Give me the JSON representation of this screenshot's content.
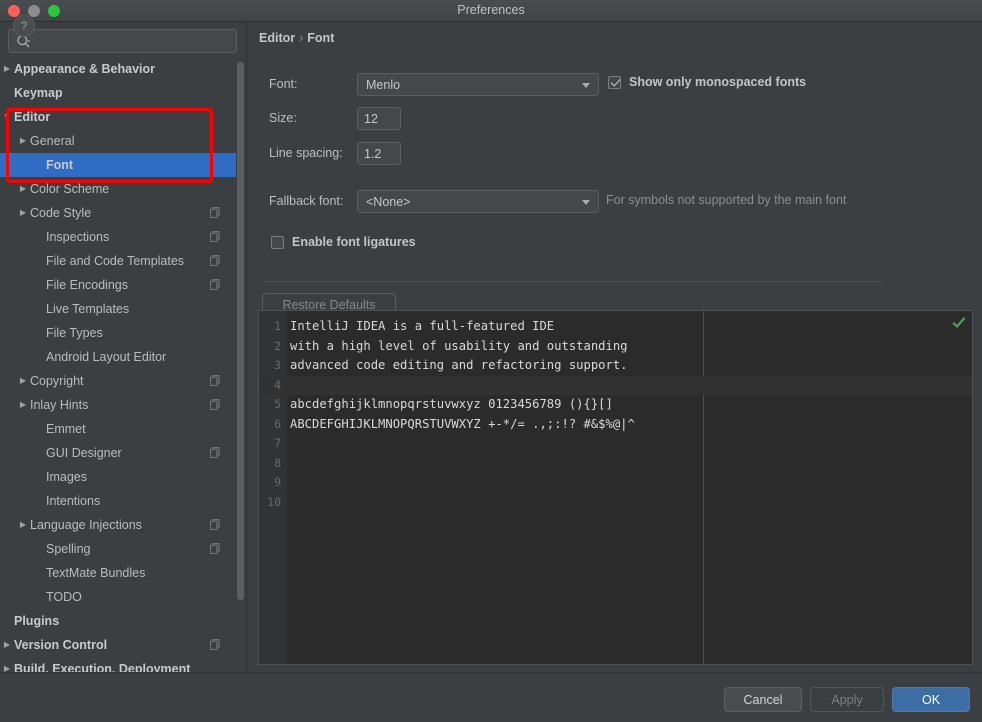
{
  "window": {
    "title": "Preferences",
    "traffic_lights": [
      "close-button",
      "minimize-button",
      "zoom-button"
    ]
  },
  "search": {
    "value": "",
    "placeholder": "",
    "icon": "search-icon"
  },
  "sidebar": {
    "items": [
      {
        "label": "Appearance & Behavior",
        "indent": 0,
        "twisty": "collapsed",
        "bold": true,
        "copy": false,
        "selected": false
      },
      {
        "label": "Keymap",
        "indent": 0,
        "twisty": "none",
        "bold": true,
        "copy": false,
        "selected": false
      },
      {
        "label": "Editor",
        "indent": 0,
        "twisty": "expanded",
        "bold": true,
        "copy": false,
        "selected": false
      },
      {
        "label": "General",
        "indent": 1,
        "twisty": "collapsed",
        "bold": false,
        "copy": false,
        "selected": false
      },
      {
        "label": "Font",
        "indent": 2,
        "twisty": "none",
        "bold": true,
        "copy": false,
        "selected": true
      },
      {
        "label": "Color Scheme",
        "indent": 1,
        "twisty": "collapsed",
        "bold": false,
        "copy": false,
        "selected": false
      },
      {
        "label": "Code Style",
        "indent": 1,
        "twisty": "collapsed",
        "bold": false,
        "copy": true,
        "selected": false
      },
      {
        "label": "Inspections",
        "indent": 2,
        "twisty": "none",
        "bold": false,
        "copy": true,
        "selected": false
      },
      {
        "label": "File and Code Templates",
        "indent": 2,
        "twisty": "none",
        "bold": false,
        "copy": true,
        "selected": false
      },
      {
        "label": "File Encodings",
        "indent": 2,
        "twisty": "none",
        "bold": false,
        "copy": true,
        "selected": false
      },
      {
        "label": "Live Templates",
        "indent": 2,
        "twisty": "none",
        "bold": false,
        "copy": false,
        "selected": false
      },
      {
        "label": "File Types",
        "indent": 2,
        "twisty": "none",
        "bold": false,
        "copy": false,
        "selected": false
      },
      {
        "label": "Android Layout Editor",
        "indent": 2,
        "twisty": "none",
        "bold": false,
        "copy": false,
        "selected": false
      },
      {
        "label": "Copyright",
        "indent": 1,
        "twisty": "collapsed",
        "bold": false,
        "copy": true,
        "selected": false
      },
      {
        "label": "Inlay Hints",
        "indent": 1,
        "twisty": "collapsed",
        "bold": false,
        "copy": true,
        "selected": false
      },
      {
        "label": "Emmet",
        "indent": 2,
        "twisty": "none",
        "bold": false,
        "copy": false,
        "selected": false
      },
      {
        "label": "GUI Designer",
        "indent": 2,
        "twisty": "none",
        "bold": false,
        "copy": true,
        "selected": false
      },
      {
        "label": "Images",
        "indent": 2,
        "twisty": "none",
        "bold": false,
        "copy": false,
        "selected": false
      },
      {
        "label": "Intentions",
        "indent": 2,
        "twisty": "none",
        "bold": false,
        "copy": false,
        "selected": false
      },
      {
        "label": "Language Injections",
        "indent": 1,
        "twisty": "collapsed",
        "bold": false,
        "copy": true,
        "selected": false
      },
      {
        "label": "Spelling",
        "indent": 2,
        "twisty": "none",
        "bold": false,
        "copy": true,
        "selected": false
      },
      {
        "label": "TextMate Bundles",
        "indent": 2,
        "twisty": "none",
        "bold": false,
        "copy": false,
        "selected": false
      },
      {
        "label": "TODO",
        "indent": 2,
        "twisty": "none",
        "bold": false,
        "copy": false,
        "selected": false
      },
      {
        "label": "Plugins",
        "indent": 0,
        "twisty": "none",
        "bold": true,
        "copy": false,
        "selected": false
      },
      {
        "label": "Version Control",
        "indent": 0,
        "twisty": "collapsed",
        "bold": true,
        "copy": true,
        "selected": false
      },
      {
        "label": "Build, Execution, Deployment",
        "indent": 0,
        "twisty": "collapsed",
        "bold": true,
        "copy": false,
        "selected": false
      }
    ]
  },
  "breadcrumb": {
    "parent": "Editor",
    "separator": "›",
    "current": "Font"
  },
  "form": {
    "font_label": "Font:",
    "font_value": "Menlo",
    "size_label": "Size:",
    "size_value": "12",
    "line_spacing_label": "Line spacing:",
    "line_spacing_value": "1.2",
    "fallback_label": "Fallback font:",
    "fallback_value": "<None>",
    "fallback_hint": "For symbols not supported by the main font",
    "monospaced_label": "Show only monospaced fonts",
    "monospaced_checked": true,
    "ligatures_label": "Enable font ligatures",
    "ligatures_checked": false,
    "restore_defaults_label": "Restore Defaults"
  },
  "preview": {
    "status_icon": "green-check-icon",
    "caret_line": 4,
    "lines": [
      {
        "num": "1",
        "text": "IntelliJ IDEA is a full-featured IDE"
      },
      {
        "num": "2",
        "text": "with a high level of usability and outstanding"
      },
      {
        "num": "3",
        "text": "advanced code editing and refactoring support."
      },
      {
        "num": "4",
        "text": ""
      },
      {
        "num": "5",
        "text": "abcdefghijklmnopqrstuvwxyz 0123456789 (){}[]"
      },
      {
        "num": "6",
        "text": "ABCDEFGHIJKLMNOPQRSTUVWXYZ +-*/= .,;:!? #&$%@|^"
      },
      {
        "num": "7",
        "text": ""
      },
      {
        "num": "8",
        "text": ""
      },
      {
        "num": "9",
        "text": ""
      },
      {
        "num": "10",
        "text": ""
      }
    ]
  },
  "footer": {
    "help_label": "?",
    "cancel_label": "Cancel",
    "apply_label": "Apply",
    "ok_label": "OK"
  },
  "colors": {
    "accent_blue": "#2f6cc4",
    "ok_button": "#3c6ea5",
    "annotation_red": "#ff0000",
    "panel_bg": "#3c3f41",
    "editor_bg": "#2b2b2b",
    "status_green": "#4f9e59"
  }
}
